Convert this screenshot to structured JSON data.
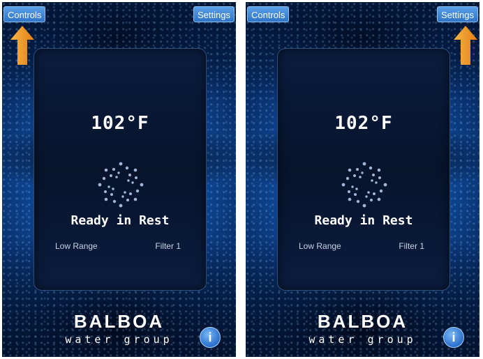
{
  "screens": [
    {
      "controls_label": "Controls",
      "settings_label": "Settings",
      "temperature": "102°F",
      "status": "Ready in Rest",
      "range": "Low Range",
      "filter": "Filter 1",
      "brand": "BALBOA",
      "brand_sub": "water group",
      "info_icon": "i",
      "highlight_arrow": "up-arrow-icon pointing to Controls"
    },
    {
      "controls_label": "Controls",
      "settings_label": "Settings",
      "temperature": "102°F",
      "status": "Ready in Rest",
      "range": "Low Range",
      "filter": "Filter 1",
      "brand": "BALBOA",
      "brand_sub": "water group",
      "info_icon": "i",
      "highlight_arrow": "up-arrow-icon pointing to Settings"
    }
  ],
  "colors": {
    "accent_arrow": "#f39a2b",
    "button_blue": "#2f74c8",
    "background_blue": "#0f4a9b"
  }
}
